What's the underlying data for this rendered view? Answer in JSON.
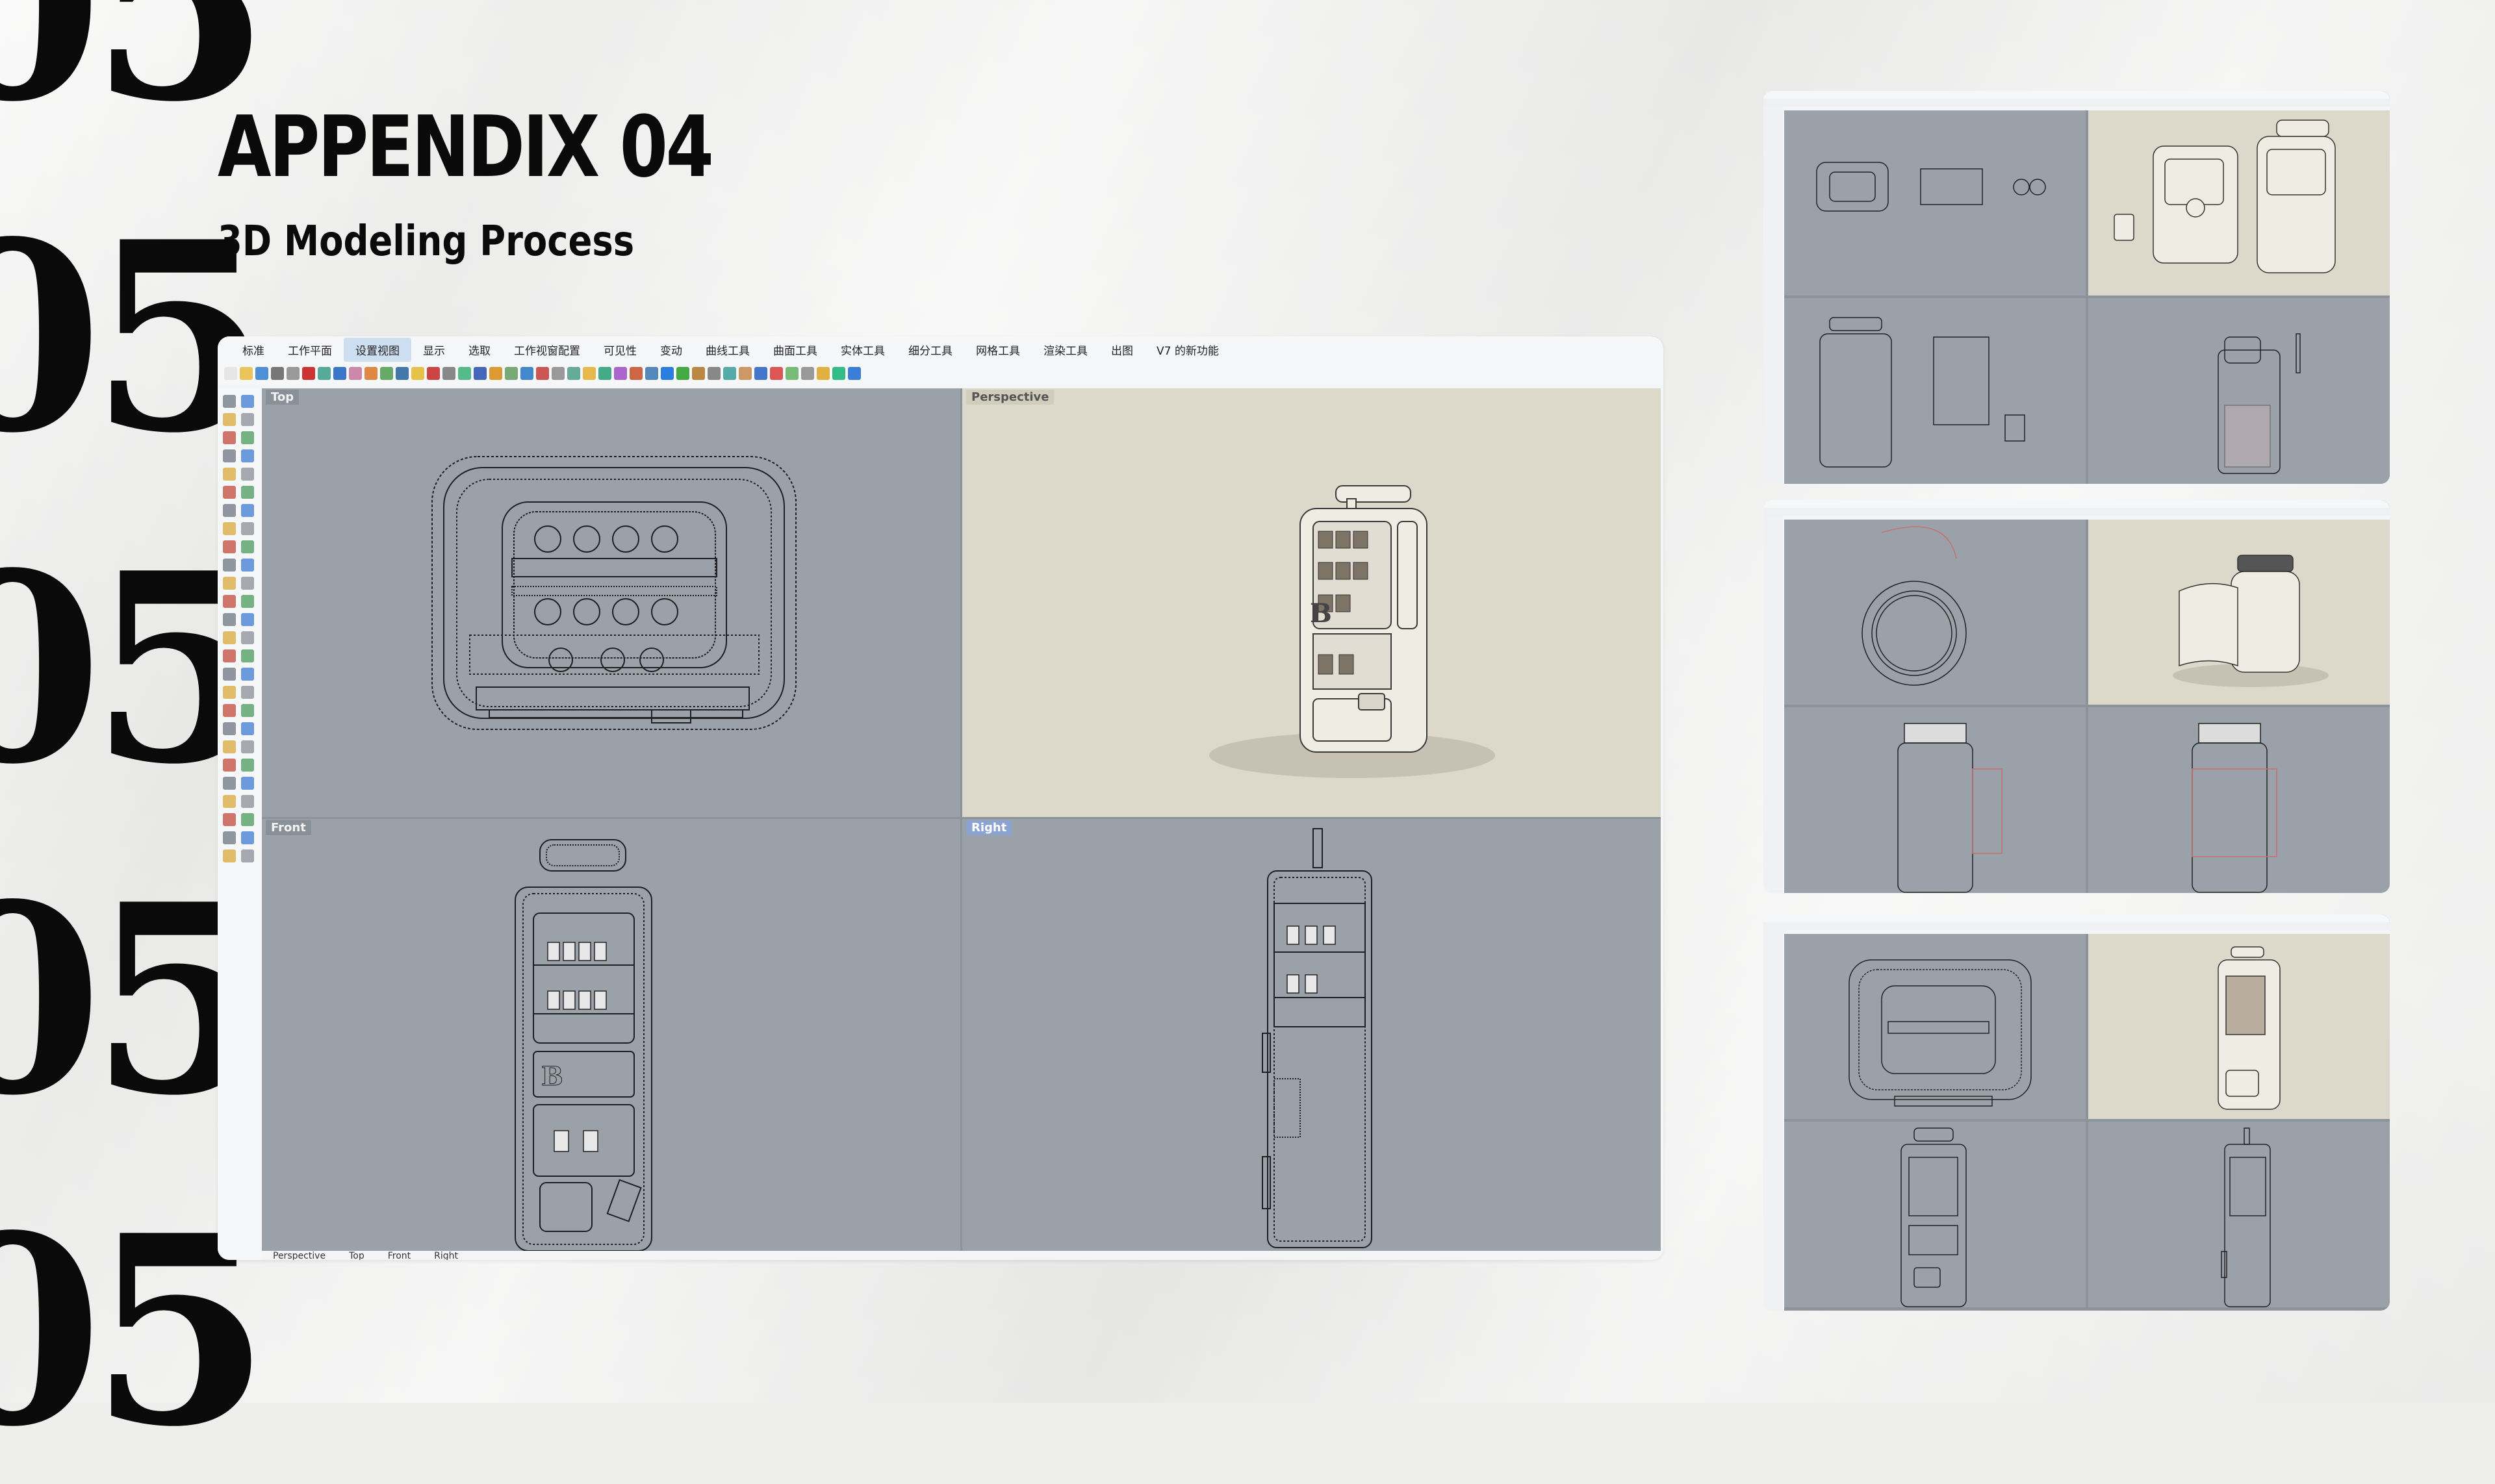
{
  "page": {
    "background_number": "05",
    "title": "APPENDIX 04",
    "subtitle": "3D Modeling Process"
  },
  "app": {
    "menu": [
      "标准",
      "工作平面",
      "设置视图",
      "显示",
      "选取",
      "工作视窗配置",
      "可见性",
      "变动",
      "曲线工具",
      "曲面工具",
      "实体工具",
      "细分工具",
      "网格工具",
      "渲染工具",
      "出图",
      "V7 的新功能"
    ],
    "active_menu": "设置视图",
    "viewports": {
      "top": "Top",
      "perspective": "Perspective",
      "front": "Front",
      "right": "Right"
    },
    "bottom_tabs": [
      "Perspective",
      "Top",
      "Front",
      "Right"
    ]
  },
  "colors": {
    "wireframe_viewport": "#9aa1a9",
    "perspective_viewport": "#dcd8ca",
    "selected_label": "#8aa3d0",
    "accent": "#2c8ce0"
  },
  "icons": [
    "new-file-icon",
    "open-icon",
    "save-icon",
    "print-icon",
    "cut-icon",
    "copy-icon",
    "paste-icon",
    "undo-icon",
    "pan-icon",
    "zoom-icon",
    "render-icon"
  ]
}
